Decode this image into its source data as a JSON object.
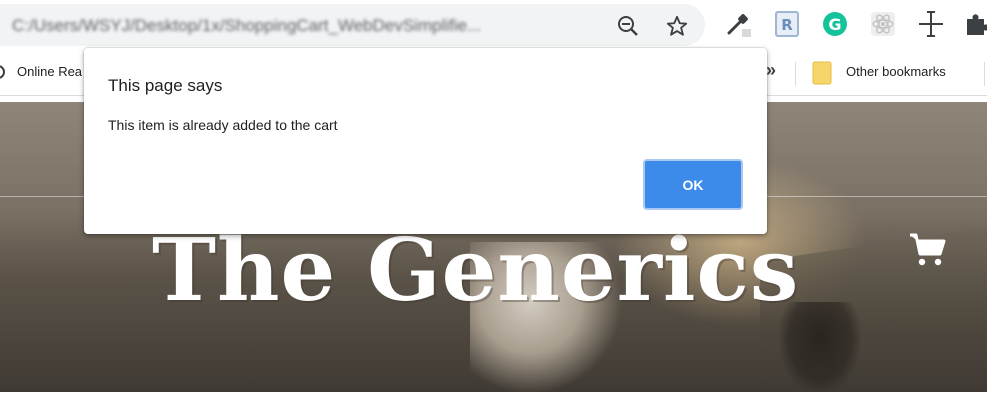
{
  "browser": {
    "url": "C:/Users/WSYJ/Desktop/1x/ShoppingCart_WebDevSimplifie...",
    "icons": [
      "zoom-out-icon",
      "bookmark-star-icon",
      "eyedropper-icon",
      "r-extension-icon",
      "grammarly-icon",
      "react-devtools-icon",
      "move-cross-icon",
      "extensions-puzzle-icon"
    ]
  },
  "bookmarks": {
    "first_label": "Online Rea",
    "overflow_label": "»",
    "other_label": "Other bookmarks"
  },
  "page": {
    "title": "The Generics",
    "cart_icon": "cart-icon"
  },
  "dialog": {
    "title": "This page says",
    "message": "This item is already added to the cart",
    "ok_label": "OK",
    "accent_color": "#3c8bea"
  }
}
